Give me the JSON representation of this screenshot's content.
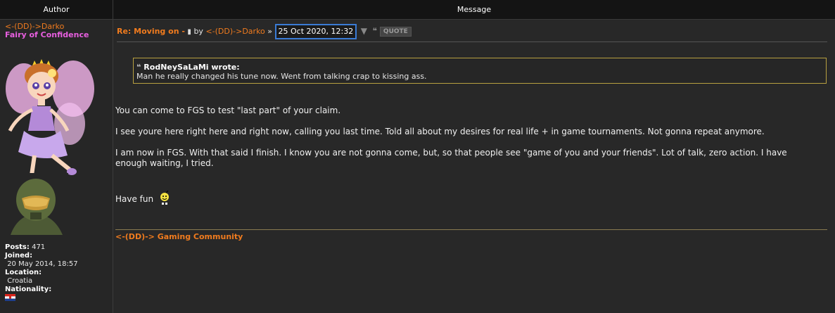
{
  "header": {
    "author": "Author",
    "message": "Message"
  },
  "author": {
    "name": "<-(DD)->Darko",
    "title": "Fairy of Confidence",
    "stats": {
      "posts_label": "Posts:",
      "posts": "471",
      "joined_label": "Joined:",
      "joined": "20 May 2014, 18:57",
      "location_label": "Location:",
      "location": "Croatia",
      "nationality_label": "Nationality:"
    }
  },
  "post": {
    "subject": "Re: Moving on -",
    "by": "by",
    "poster": "<-(DD)->Darko",
    "separator": "»",
    "date": "25 Oct 2020, 12:32",
    "quote_button": "QUOTE",
    "quote": {
      "author": "RodNeySaLaMi wrote:",
      "text": "Man he really changed his tune now. Went from talking crap to kissing ass."
    },
    "paragraphs": [
      "You can come to FGS to test \"last part\" of your claim.",
      "I see youre here right here and right now, calling you last time. Told all about my desires for real life + in game tournaments. Not gonna repeat anymore.",
      "I am now in FGS. With that said I finish. I know you are not gonna come, but, so that people see \"game of you and your friends\". Lot of talk, zero action. I have enough waiting, I tried.",
      "Have fun"
    ],
    "signature": "<-(DD)-> Gaming Community"
  }
}
